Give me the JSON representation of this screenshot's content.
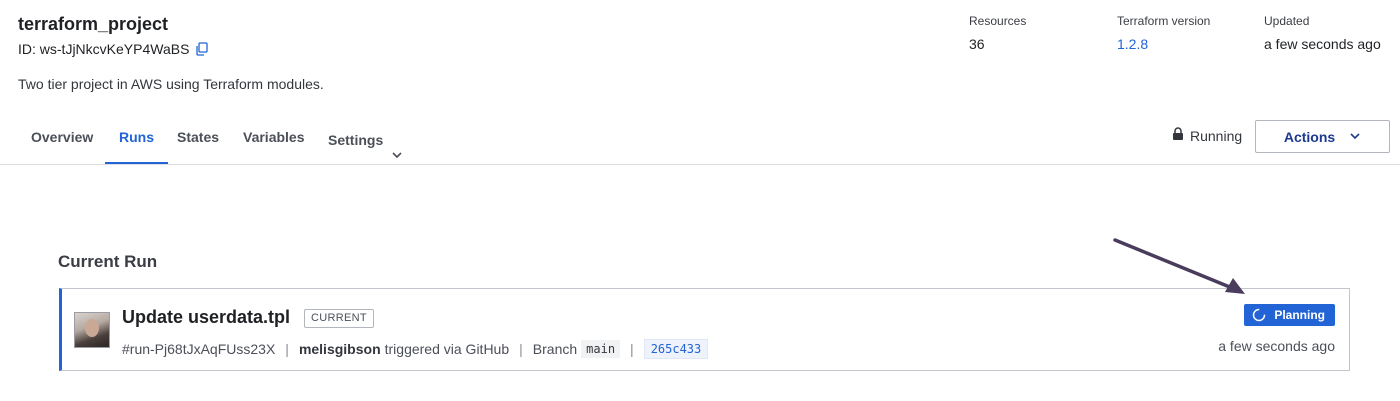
{
  "workspace": {
    "title": "terraform_project",
    "id": "ID: ws-tJjNkcvKeYP4WaBS",
    "description": "Two tier project in AWS using Terraform modules."
  },
  "meta": {
    "resources_label": "Resources",
    "resources_value": "36",
    "tf_version_label": "Terraform version",
    "tf_version_value": "1.2.8",
    "updated_label": "Updated",
    "updated_value": "a few seconds ago"
  },
  "tabs": [
    {
      "label": "Overview"
    },
    {
      "label": "Runs"
    },
    {
      "label": "States"
    },
    {
      "label": "Variables"
    },
    {
      "label": "Settings"
    }
  ],
  "status": {
    "label": "Running"
  },
  "actions": {
    "label": "Actions"
  },
  "current_run": {
    "section_title": "Current Run",
    "title": "Update userdata.tpl",
    "badge": "CURRENT",
    "run_id": "#run-Pj68tJxAqFUss23X",
    "user": "melisgibson",
    "trigger": "triggered via GitHub",
    "branch_label": "Branch",
    "branch": "main",
    "commit": "265c433",
    "status": "Planning",
    "time": "a few seconds ago"
  },
  "colors": {
    "accent": "#2264d6",
    "arrow": "#4a3c5c"
  }
}
